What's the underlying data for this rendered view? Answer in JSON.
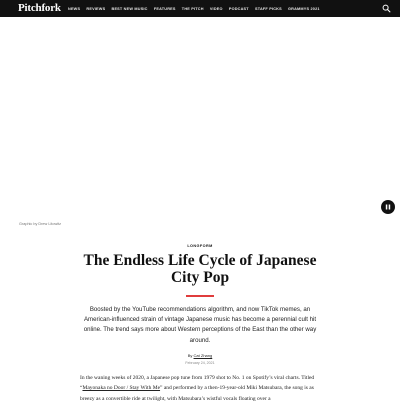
{
  "header": {
    "logo": "Pitchfork",
    "nav": [
      "NEWS",
      "REVIEWS",
      "BEST NEW MUSIC",
      "FEATURES",
      "THE PITCH",
      "VIDEO",
      "PODCAST",
      "STAFF PICKS",
      "GRAMMYS 2021"
    ],
    "search_icon": "search-icon"
  },
  "hero": {
    "caption": "Graphic by Drew Litowitz",
    "pause_icon": "pause-icon"
  },
  "article": {
    "kicker": "LONGFORM",
    "title": "The Endless Life Cycle of Japanese City Pop",
    "dek": "Boosted by the YouTube recommendations algorithm, and now TikTok memes, an American-influenced strain of vintage Japanese music has become a perennial cult hit online. The trend says more about Western perceptions of the East than the other way around.",
    "byline_prefix": "By ",
    "author": "Cat Zhang",
    "date": "February 24, 2021",
    "body_intro": "In the waning weeks of 2020, a Japanese pop tune from 1979 shot to No. 1 on Spotify’s viral charts. Titled “",
    "body_link": "Mayonaka no Door / Stay With Me",
    "body_rest": "” and performed by a then-19-year-old Miki Matsubara, the song is as breezy as a convertible ride at twilight, with Matsubara’s wistful vocals floating over a"
  },
  "colors": {
    "header_bg": "#111111",
    "accent_rule": "#e03c3c"
  }
}
